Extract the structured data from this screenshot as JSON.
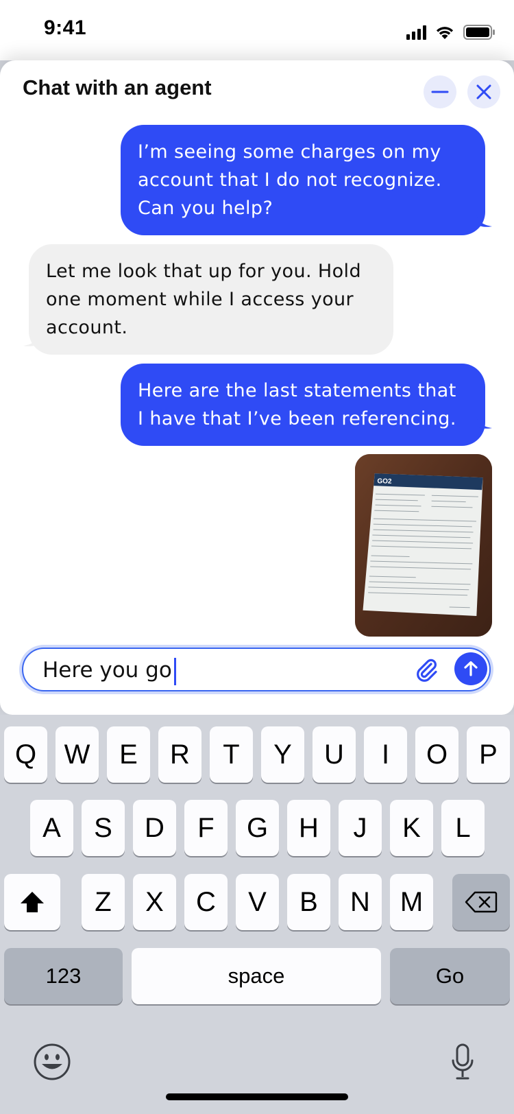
{
  "status_bar": {
    "time": "9:41"
  },
  "chat": {
    "title": "Chat with an agent",
    "messages": [
      {
        "from": "user",
        "text": "I’m seeing some charges on my account that I do not recognize. Can you help?"
      },
      {
        "from": "agent",
        "text": "Let me look that up for you. Hold one moment while I access your account."
      },
      {
        "from": "user",
        "text": "Here are the last statements that I have that I’ve been referencing."
      }
    ],
    "attachment": {
      "brand": "GO2",
      "kind": "statement-photo"
    }
  },
  "composer": {
    "value": "Here you go"
  },
  "keyboard": {
    "row1": [
      "Q",
      "W",
      "E",
      "R",
      "T",
      "Y",
      "U",
      "I",
      "O",
      "P"
    ],
    "row2": [
      "A",
      "S",
      "D",
      "F",
      "G",
      "H",
      "J",
      "K",
      "L"
    ],
    "row3": [
      "Z",
      "X",
      "C",
      "V",
      "B",
      "N",
      "M"
    ],
    "numbers_label": "123",
    "space_label": "space",
    "go_label": "Go"
  },
  "colors": {
    "accent": "#2f4bf5",
    "agent_bubble": "#f0f0f0",
    "keyboard_bg": "#d1d4db"
  },
  "icons": [
    "minimize-icon",
    "close-icon",
    "paperclip-icon",
    "send-arrow-icon",
    "shift-icon",
    "backspace-icon",
    "emoji-icon",
    "mic-icon"
  ]
}
